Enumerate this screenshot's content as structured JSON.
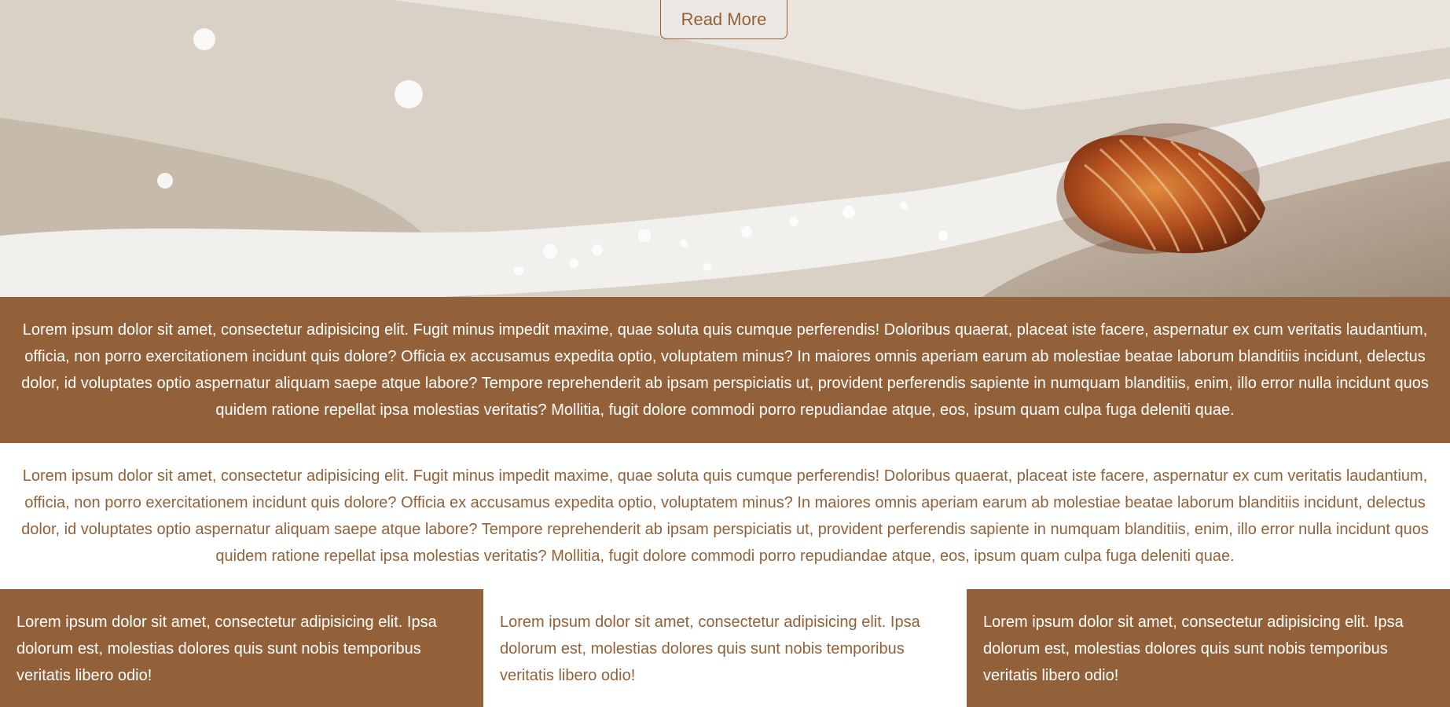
{
  "hero": {
    "read_more_label": "Read More",
    "image": "beach-seashell-foam-photo"
  },
  "band_brown": {
    "text": "Lorem ipsum dolor sit amet, consectetur adipisicing elit. Fugit minus impedit maxime, quae soluta quis cumque perferendis! Doloribus quaerat, placeat iste facere, aspernatur ex cum veritatis laudantium, officia, non porro exercitationem incidunt quis dolore? Officia ex accusamus expedita optio, voluptatem minus? In maiores omnis aperiam earum ab molestiae beatae laborum blanditiis incidunt, delectus dolor, id voluptates optio aspernatur aliquam saepe atque labore? Tempore reprehenderit ab ipsam perspiciatis ut, provident perferendis sapiente in numquam blanditiis, enim, illo error nulla incidunt quos quidem ratione repellat ipsa molestias veritatis? Mollitia, fugit dolore commodi porro repudiandae atque, eos, ipsum quam culpa fuga deleniti quae."
  },
  "band_white": {
    "text": "Lorem ipsum dolor sit amet, consectetur adipisicing elit. Fugit minus impedit maxime, quae soluta quis cumque perferendis! Doloribus quaerat, placeat iste facere, aspernatur ex cum veritatis laudantium, officia, non porro exercitationem incidunt quis dolore? Officia ex accusamus expedita optio, voluptatem minus? In maiores omnis aperiam earum ab molestiae beatae laborum blanditiis incidunt, delectus dolor, id voluptates optio aspernatur aliquam saepe atque labore? Tempore reprehenderit ab ipsam perspiciatis ut, provident perferendis sapiente in numquam blanditiis, enim, illo error nulla incidunt quos quidem ratione repellat ipsa molestias veritatis? Mollitia, fugit dolore commodi porro repudiandae atque, eos, ipsum quam culpa fuga deleniti quae."
  },
  "columns": [
    {
      "text": "Lorem ipsum dolor sit amet, consectetur adipisicing elit. Ipsa dolorum est, molestias dolores quis sunt nobis temporibus veritatis libero odio!"
    },
    {
      "text": "Lorem ipsum dolor sit amet, consectetur adipisicing elit. Ipsa dolorum est, molestias dolores quis sunt nobis temporibus veritatis libero odio!"
    },
    {
      "text": "Lorem ipsum dolor sit amet, consectetur adipisicing elit. Ipsa dolorum est, molestias dolores quis sunt nobis temporibus veritatis libero odio!"
    }
  ],
  "colors": {
    "brand_brown": "#936139",
    "white": "#ffffff"
  }
}
